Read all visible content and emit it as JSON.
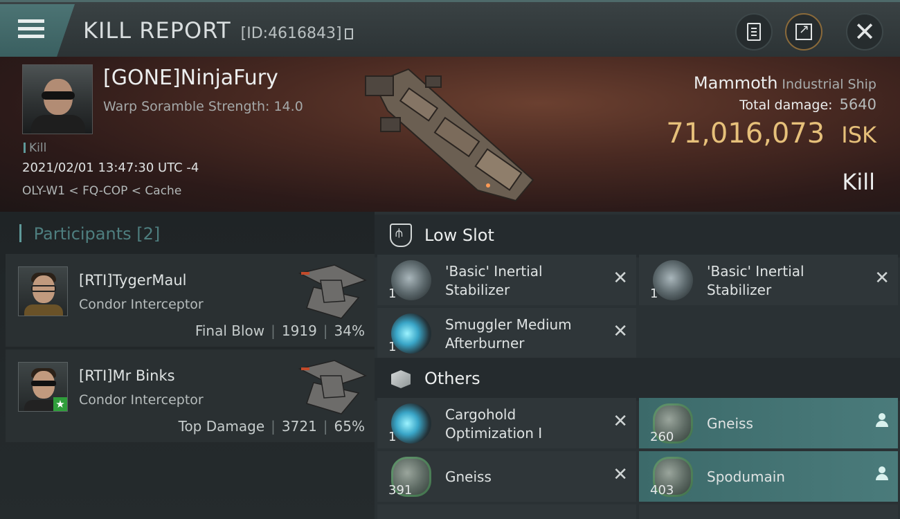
{
  "header": {
    "title": "KILL REPORT",
    "report_id": "[ID:4616843]",
    "icons": {
      "menu": "menu-icon",
      "copy": "copy-icon",
      "clipboard": "clipboard-icon",
      "share": "share-icon",
      "close": "close-icon"
    }
  },
  "victim": {
    "name": "[GONE]NinjaFury",
    "subtitle": "Warp Soramble Strength: 14.0",
    "tag": "Kill",
    "datetime": "2021/02/01 13:47:30 UTC -4",
    "location": "OLY-W1 < FQ-COP < Cache",
    "ship_name": "Mammoth",
    "ship_class": "Industrial Ship",
    "total_damage_label": "Total damage:",
    "total_damage": "5640",
    "isk_value": "71,016,073",
    "isk_unit": "ISK",
    "result": "Kill"
  },
  "participants": {
    "label": "Participants",
    "count": "[2]",
    "rows": [
      {
        "name": "[RTI]TygerMaul",
        "ship": "Condor Interceptor",
        "role": "Final Blow",
        "damage": "1919",
        "percent": "34%"
      },
      {
        "name": "[RTI]Mr Binks",
        "ship": "Condor Interceptor",
        "role": "Top Damage",
        "damage": "3721",
        "percent": "65%"
      }
    ]
  },
  "slots": {
    "low_label": "Low Slot",
    "others_label": "Others",
    "low_items": [
      {
        "qty": "1",
        "name_line1": "'Basic' Inertial",
        "name_line2": "Stabilizer"
      },
      {
        "qty": "1",
        "name_line1": "'Basic' Inertial",
        "name_line2": "Stabilizer"
      },
      {
        "qty": "1",
        "name_line1": "Smuggler Medium",
        "name_line2": "Afterburner"
      }
    ],
    "other_items": [
      {
        "qty": "1",
        "name_line1": "Cargohold",
        "name_line2": "Optimization I"
      },
      {
        "qty": "260",
        "name": "Gneiss"
      },
      {
        "qty": "391",
        "name": "Gneiss"
      },
      {
        "qty": "403",
        "name": "Spodumain"
      }
    ]
  },
  "colors": {
    "accent_teal": "#5f9a9a",
    "isk_gold": "#e6c07a",
    "highlight_row": "#4a7b7b"
  }
}
